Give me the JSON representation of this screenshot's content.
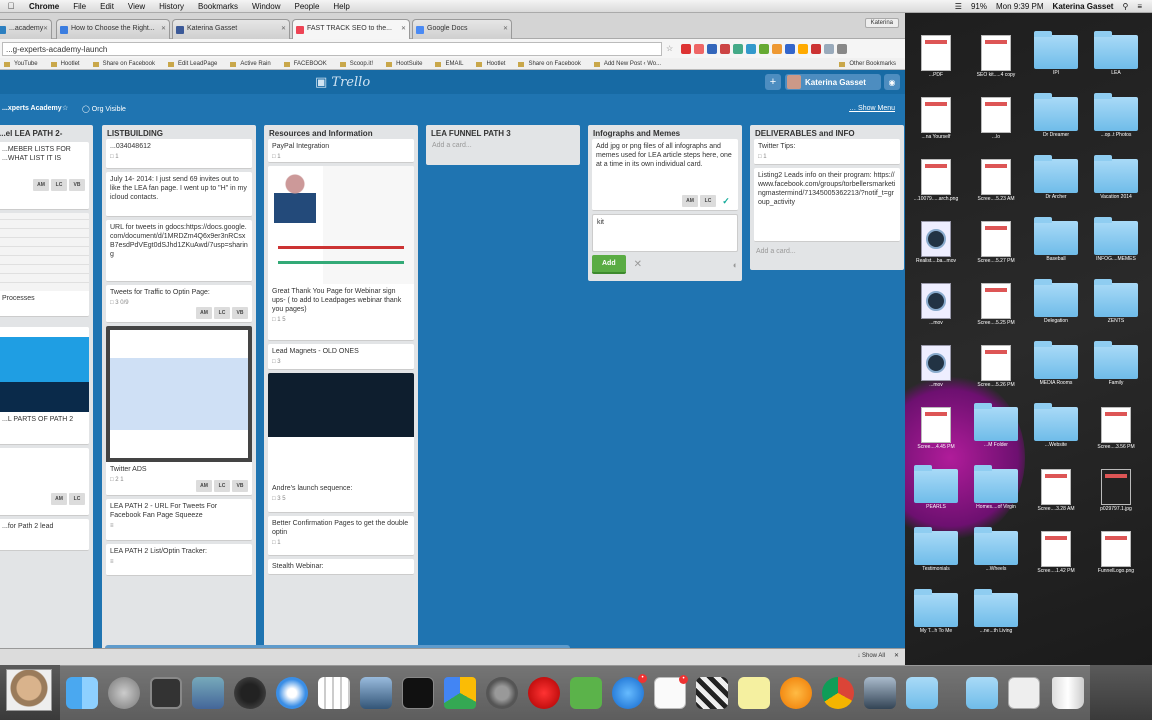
{
  "menubar": {
    "app": "Chrome",
    "items": [
      "File",
      "Edit",
      "View",
      "History",
      "Bookmarks",
      "Window",
      "People",
      "Help"
    ],
    "battery": "91%",
    "clock": "Mon 9:39 PM",
    "user": "Katerina Gasset"
  },
  "tabs": [
    {
      "label": "...academy",
      "color": "#2c7fc0"
    },
    {
      "label": "How to Choose the Right...",
      "color": "#3b7de0"
    },
    {
      "label": "Katerina Gasset",
      "color": "#3b5998"
    },
    {
      "label": "FAST TRACK SEO to the...",
      "color": "#e45"
    },
    {
      "label": "Google Docs",
      "color": "#4a8af4"
    }
  ],
  "profile": "Katerina",
  "omnibox": {
    "url": "...g-experts-academy-launch"
  },
  "bookmarks": [
    "YouTube",
    "Hootlet",
    "Share on Facebook",
    "Edit LeadPage",
    "Active Rain",
    "FACEBOOK",
    "Scoop.it!",
    "HootSuite",
    "EMAIL",
    "Hootlet",
    "Share on Facebook",
    "Add New Post ‹ Wo...",
    "Other Bookmarks"
  ],
  "trello": {
    "logo": "Trello",
    "user": "Katerina Gasset",
    "board_name": "...xperts Academy",
    "org": "Org Visible",
    "show_menu": "Show Menu",
    "add_card": "Add a card...",
    "lists": [
      {
        "title": "...el LEA PATH 2-",
        "cards": [
          {
            "text": "...MEBER LISTS FOR ...WHAT LIST IT IS"
          },
          {
            "text": "Processes"
          },
          {
            "text": "...L PARTS OF PATH 2"
          },
          {
            "text": "...for Path 2 lead"
          }
        ]
      },
      {
        "title": "LISTBUILDING",
        "cards": [
          {
            "text": "...034048612",
            "meta": "1"
          },
          {
            "text": "July 14- 2014: I just send 69 invites out to like the LEA fan page. I went up to \"H\" in my icloud contacts."
          },
          {
            "text": "URL for tweets in gdocs:https://docs.google.com/document/d/1MRDZm4Q6x9er3nRCsxB7esdPdVEgt0dSJhd1ZKuAwd/7usp=sharing"
          },
          {
            "text": "Tweets for Traffic to Optin Page:",
            "meta": "3   0/9"
          },
          {
            "text": "Twitter ADS",
            "meta": "2   1"
          },
          {
            "text": "LEA PATH 2 - URL For Tweets For Facebook Fan Page Squeeze"
          },
          {
            "text": "LEA PATH 2 List/Optin Tracker:"
          }
        ]
      },
      {
        "title": "Resources and Information",
        "cards": [
          {
            "text": "PayPal Integration",
            "meta": "1"
          },
          {
            "text": "Great Thank You Page for Webinar sign ups- ( to add to Leadpages webinar thank you pages)",
            "meta": "1   5"
          },
          {
            "text": "Lead Magnets - OLD ONES",
            "meta": "3"
          },
          {
            "text": "Andre's launch sequence:",
            "meta": "3   5"
          },
          {
            "text": "Better Confirmation Pages to get the double optin",
            "meta": "1"
          },
          {
            "text": "Stealth Webinar:"
          }
        ]
      },
      {
        "title": "LEA FUNNEL PATH 3",
        "cards": []
      },
      {
        "title": "Infographs and Memes",
        "cards": [
          {
            "text": "Add jpg or png files of all infographs and memes used for LEA article steps here, one at a time in its own individual card."
          }
        ],
        "composer": "kit",
        "add_label": "Add"
      },
      {
        "title": "DELIVERABLES and INFO",
        "cards": [
          {
            "text": "Twitter Tips:",
            "meta": "1"
          },
          {
            "text": "Listing2 Leads info on their program: https://www.facebook.com/groups/torbellersmarketingmastermind/71345005362213/?notif_t=group_activity"
          }
        ]
      }
    ],
    "members": [
      "AM",
      "LC",
      "VB"
    ]
  },
  "bottombar": {
    "show_all": "Show All"
  },
  "desktop": [
    {
      "label": "...PDF"
    },
    {
      "label": "SEO kit.....4 copy"
    },
    {
      "label": "IPI"
    },
    {
      "label": "LEA"
    },
    {
      "label": "...na Yourself"
    },
    {
      "label": "...lo"
    },
    {
      "label": "Dr Dreamer"
    },
    {
      "label": "...op..t Photos"
    },
    {
      "label": "...10079.....arch.png"
    },
    {
      "label": "Scree....5.23 AM"
    },
    {
      "label": "Dr Archer"
    },
    {
      "label": "Vacation 2014"
    },
    {
      "label": "Realist....ba...mov"
    },
    {
      "label": "Scree....5.27 PM"
    },
    {
      "label": "Baseball"
    },
    {
      "label": "INFOG....MEMES"
    },
    {
      "label": "...mov"
    },
    {
      "label": "Scree....5.25 PM"
    },
    {
      "label": "Delegation"
    },
    {
      "label": "ZENTS"
    },
    {
      "label": "...mov"
    },
    {
      "label": "Scree....5.26 PM"
    },
    {
      "label": "MEDIA Rooms"
    },
    {
      "label": "Family"
    },
    {
      "label": "Scree....4.45 PM"
    },
    {
      "label": "...M Folder"
    },
    {
      "label": "...Website"
    },
    {
      "label": "Scree....3.56 PM"
    },
    {
      "label": "PEARLS"
    },
    {
      "label": "Homes....of Virgin"
    },
    {
      "label": "Scree....3.28 AM"
    },
    {
      "label": "p029797.1.jpg"
    },
    {
      "label": "Testimonials"
    },
    {
      "label": "...Wheels"
    },
    {
      "label": "Scree....1.42 PM"
    },
    {
      "label": "FunnelLogo.png"
    },
    {
      "label": "My T...h To Me"
    },
    {
      "label": "...ne...th Living"
    }
  ],
  "colors": {
    "trello_blue": "#1f74b1",
    "trello_header": "#176aa4",
    "add_green": "#5aac44"
  }
}
